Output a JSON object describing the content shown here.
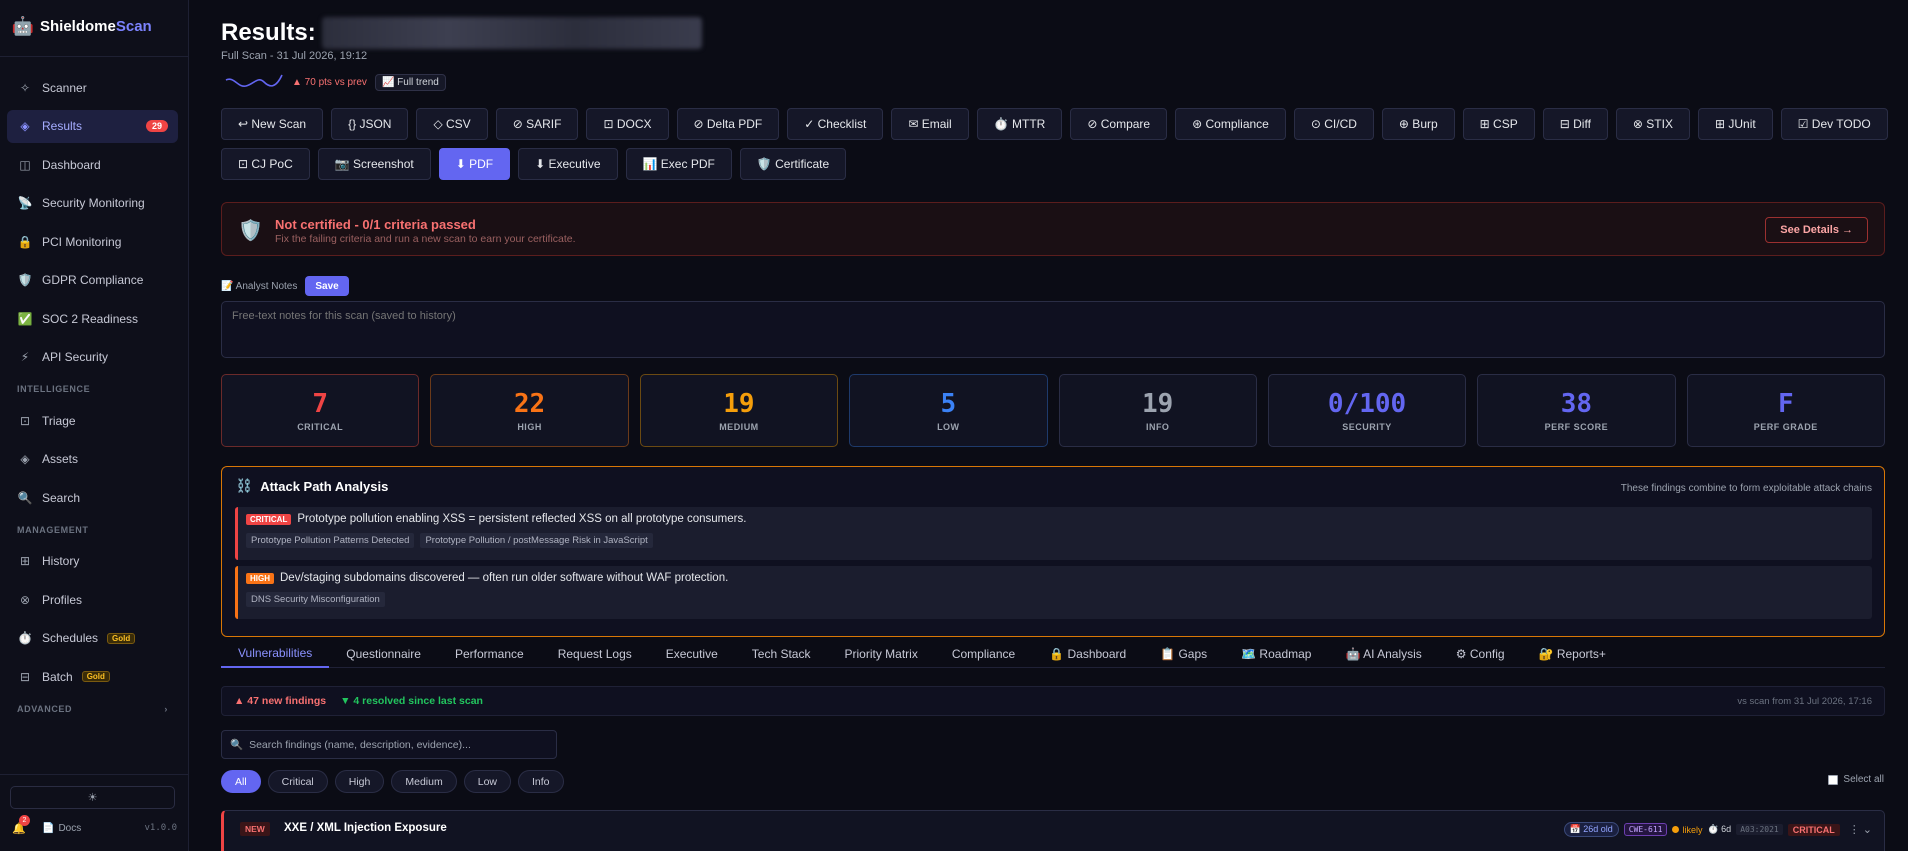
{
  "brand": {
    "name": "Shieldome",
    "accent": "Scan",
    "logo_icon": "robot-icon"
  },
  "sidebar": {
    "items_top": [
      {
        "label": "Scanner",
        "icon": "✧"
      },
      {
        "label": "Results",
        "icon": "◈",
        "badge": "29",
        "active": true
      },
      {
        "label": "Dashboard",
        "icon": "◫"
      },
      {
        "label": "Security Monitoring",
        "icon": "📡"
      },
      {
        "label": "PCI Monitoring",
        "icon": "🔒"
      },
      {
        "label": "GDPR Compliance",
        "icon": "🛡️"
      },
      {
        "label": "SOC 2 Readiness",
        "icon": "✅"
      },
      {
        "label": "API Security",
        "icon": "⚡"
      }
    ],
    "intelligence_label": "INTELLIGENCE",
    "items_intel": [
      {
        "label": "Triage",
        "icon": "⊡"
      },
      {
        "label": "Assets",
        "icon": "◈"
      },
      {
        "label": "Search",
        "icon": "🔍"
      }
    ],
    "management_label": "MANAGEMENT",
    "items_mgmt": [
      {
        "label": "History",
        "icon": "⊞"
      },
      {
        "label": "Profiles",
        "icon": "⊗"
      },
      {
        "label": "Schedules",
        "icon": "⏱️",
        "gold": "Gold"
      },
      {
        "label": "Batch",
        "icon": "⊟",
        "gold": "Gold"
      }
    ],
    "advanced_label": "ADVANCED",
    "theme_icon": "☀",
    "notif_count": "2",
    "docs_label": "Docs",
    "version": "v1.0.0"
  },
  "header": {
    "title": "Results:",
    "subtitle": "Full Scan - 31 Jul 2026, 19:12",
    "trend_text": "▲ 70 pts vs prev",
    "trend_btn": "📈 Full trend"
  },
  "toolbar": {
    "row1": [
      "↩ New Scan",
      "{} JSON",
      "◇ CSV",
      "⊘ SARIF",
      "⊡ DOCX",
      "⊘ Delta PDF",
      "✓ Checklist",
      "✉ Email",
      "⏱️ MTTR",
      "⊘ Compare",
      "⊛ Compliance",
      "⊙ CI/CD",
      "⊕ Burp",
      "⊞ CSP",
      "⊟ Diff",
      "⊗ STIX",
      "⊞ JUnit",
      "☑ Dev TODO"
    ],
    "row2": [
      "⊡ CJ PoC",
      "📷 Screenshot",
      "⬇ PDF",
      "⬇ Executive",
      "📊 Exec PDF",
      "🛡️ Certificate"
    ],
    "primary": "⬇ PDF"
  },
  "certification": {
    "icon": "🛡️",
    "title": "Not certified - 0/1 criteria passed",
    "subtitle": "Fix the failing criteria and run a new scan to earn your certificate.",
    "button": "See Details →"
  },
  "notes": {
    "label": "📝 Analyst Notes",
    "save": "Save",
    "placeholder": "Free-text notes for this scan (saved to history)"
  },
  "stats": [
    {
      "value": "7",
      "label": "CRITICAL",
      "color": "#ef4444",
      "border": "#6b2a2a"
    },
    {
      "value": "22",
      "label": "HIGH",
      "color": "#f97316",
      "border": "#6b3a1a"
    },
    {
      "value": "19",
      "label": "MEDIUM",
      "color": "#f59e0b",
      "border": "#6b4a12"
    },
    {
      "value": "5",
      "label": "LOW",
      "color": "#3b82f6",
      "border": "#1e3a6b"
    },
    {
      "value": "19",
      "label": "INFO",
      "color": "#9ca3af",
      "border": "#2a2d45"
    },
    {
      "value": "0/100",
      "label": "SECURITY",
      "color": "#6366f1",
      "border": "#2a2d45"
    },
    {
      "value": "38",
      "label": "PERF SCORE",
      "color": "#6366f1",
      "border": "#2a2d45"
    },
    {
      "value": "F",
      "label": "PERF GRADE",
      "color": "#6366f1",
      "border": "#2a2d45"
    }
  ],
  "attack": {
    "icon": "⛓️",
    "title": "Attack Path Analysis",
    "note": "These findings combine to form exploitable attack chains",
    "chains": [
      {
        "severity": "CRITICAL",
        "text": "Prototype pollution enabling XSS = persistent reflected XSS on all prototype consumers.",
        "chips": [
          "Prototype Pollution Patterns Detected",
          "Prototype Pollution / postMessage Risk in JavaScript"
        ]
      },
      {
        "severity": "HIGH",
        "text": "Dev/staging subdomains discovered — often run older software without WAF protection.",
        "chips": [
          "DNS Security Misconfiguration"
        ]
      }
    ]
  },
  "tabs": [
    "Vulnerabilities",
    "Questionnaire",
    "Performance",
    "Request Logs",
    "Executive",
    "Tech Stack",
    "Priority Matrix",
    "Compliance",
    "🔒 Dashboard",
    "📋 Gaps",
    "🗺️ Roadmap",
    "🤖 AI Analysis",
    "⚙ Config",
    "🔐 Reports+"
  ],
  "delta": {
    "new": "▲ 47 new findings",
    "resolved": "▼ 4 resolved since last scan",
    "vs": "vs scan from 31 Jul 2026, 17:16"
  },
  "search": {
    "placeholder": "Search findings (name, description, evidence)...",
    "icon": "🔍"
  },
  "filters": [
    "All",
    "Critical",
    "High",
    "Medium",
    "Low",
    "Info"
  ],
  "select_all": "Select all",
  "finding": {
    "tag": "NEW",
    "title": "XXE / XML Injection Exposure",
    "age": "📅 26d old",
    "cwe": "CWE-611",
    "likely": "likely",
    "time": "⏱️ 6d",
    "owasp": "A03:2021",
    "severity": "CRITICAL",
    "more": "⋮ ⌄"
  }
}
